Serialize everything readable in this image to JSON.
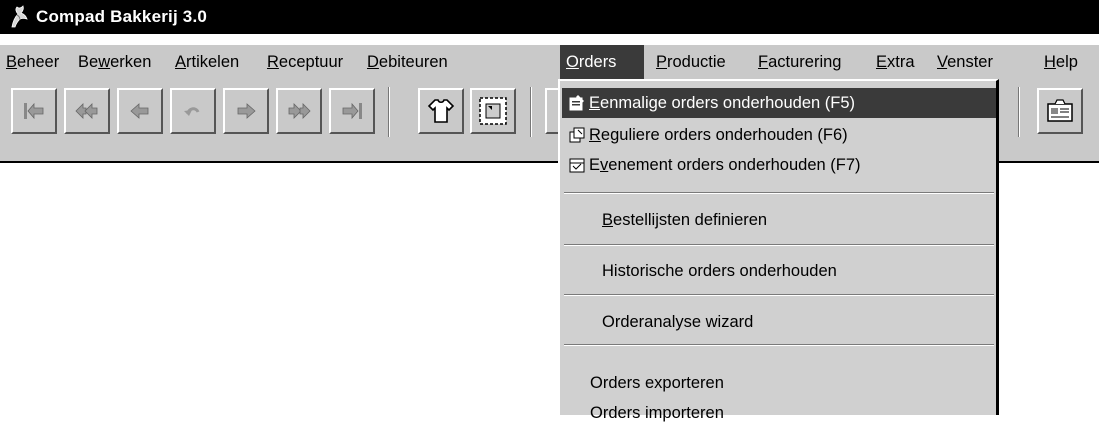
{
  "window": {
    "title": "Compad Bakkerij 3.0",
    "icon": "bakery-logo-icon"
  },
  "menubar": [
    {
      "id": "beheer",
      "label": "Beheer",
      "underline": "B",
      "rest": "eheer"
    },
    {
      "id": "bewerken",
      "pre": "Be",
      "underline": "w",
      "rest": "erken"
    },
    {
      "id": "artikelen",
      "pre": "",
      "underline": "A",
      "rest": "rtikelen"
    },
    {
      "id": "receptuur",
      "pre": "",
      "underline": "R",
      "rest": "eceptuur"
    },
    {
      "id": "debiteuren",
      "pre": "",
      "underline": "D",
      "rest": "ebiteuren"
    },
    {
      "id": "orders",
      "pre": "",
      "underline": "O",
      "rest": "rders",
      "active": true
    },
    {
      "id": "productie",
      "pre": "",
      "underline": "P",
      "rest": "roductie"
    },
    {
      "id": "facturering",
      "pre": "",
      "underline": "F",
      "rest": "acturering"
    },
    {
      "id": "extra",
      "pre": "",
      "underline": "E",
      "rest": "xtra"
    },
    {
      "id": "venster",
      "pre": "",
      "underline": "V",
      "rest": "enster"
    },
    {
      "id": "help",
      "pre": "",
      "underline": "H",
      "rest": "elp"
    }
  ],
  "toolbar": {
    "buttons": [
      "first-record-icon",
      "previous-page-icon",
      "previous-record-icon",
      "undo-icon",
      "next-record-icon",
      "next-page-icon",
      "last-record-icon",
      "shirt-icon",
      "select-icon",
      "card-file-icon"
    ]
  },
  "orders_menu": {
    "items": [
      {
        "pre": "",
        "underline": "E",
        "rest": "enmalige orders onderhouden  (F5)",
        "icon": "order-edit-icon",
        "highlighted": true
      },
      {
        "pre": "",
        "underline": "R",
        "rest": "eguliere orders onderhouden  (F6)",
        "icon": "recurring-order-icon"
      },
      {
        "pre": "E",
        "underline": "v",
        "rest": "enement orders onderhouden  (F7)",
        "icon": "event-order-icon"
      },
      {
        "pre": "",
        "underline": "B",
        "rest": "estellijsten definieren"
      },
      {
        "text": "Historische orders onderhouden"
      },
      {
        "text": "Orderanalyse wizard"
      },
      {
        "text": "Orders exporteren"
      },
      {
        "text": "Orders importeren"
      }
    ]
  },
  "colors": {
    "chrome": "#c9c9c9",
    "highlight": "#3a3a3a",
    "title_bar": "#000000"
  }
}
